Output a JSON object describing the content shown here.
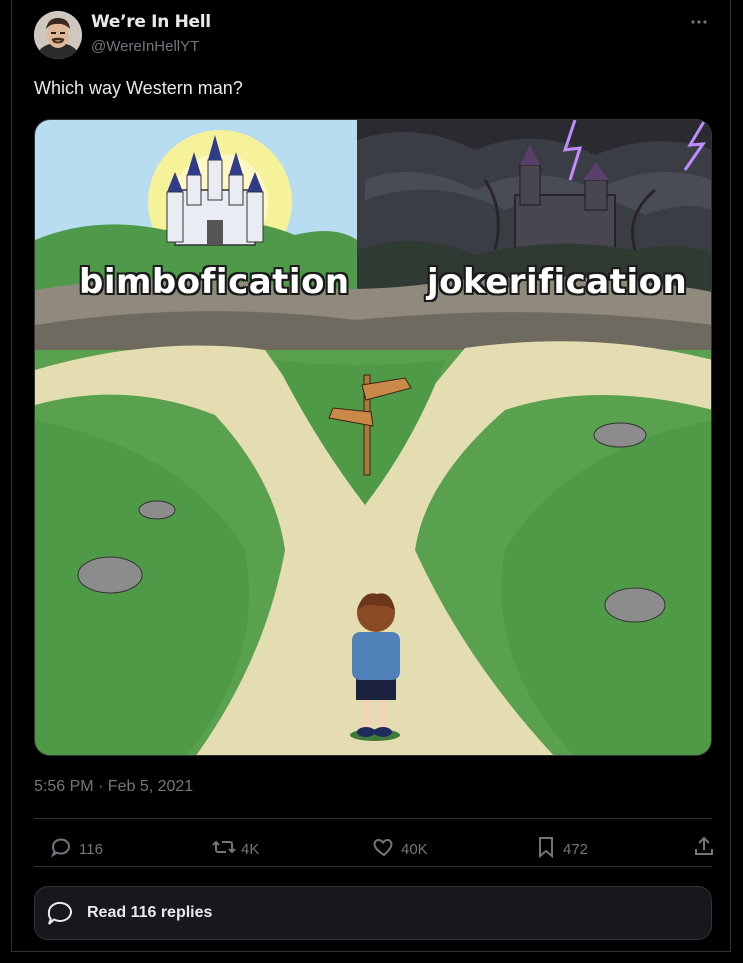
{
  "tweet": {
    "author": {
      "name": "We’re In Hell",
      "handle": "@WereInHellYT"
    },
    "text": "Which way Western man?",
    "timestamp": "5:56 PM · Feb 5, 2021",
    "media": {
      "left_label": "bimbofication",
      "right_label": "jokerification"
    }
  },
  "actions": {
    "replies": "116",
    "reposts": "4K",
    "likes": "40K",
    "bookmarks": "472"
  },
  "read_replies_label": "Read 116 replies",
  "icons": {
    "more": "more-icon",
    "reply": "reply-icon",
    "repost": "repost-icon",
    "like": "heart-icon",
    "bookmark": "bookmark-icon",
    "share": "share-icon",
    "read_replies": "speech-bubble-icon"
  },
  "colors": {
    "background": "#000000",
    "text": "#e7e9ea",
    "muted": "#71767b",
    "border": "#2f3336"
  }
}
